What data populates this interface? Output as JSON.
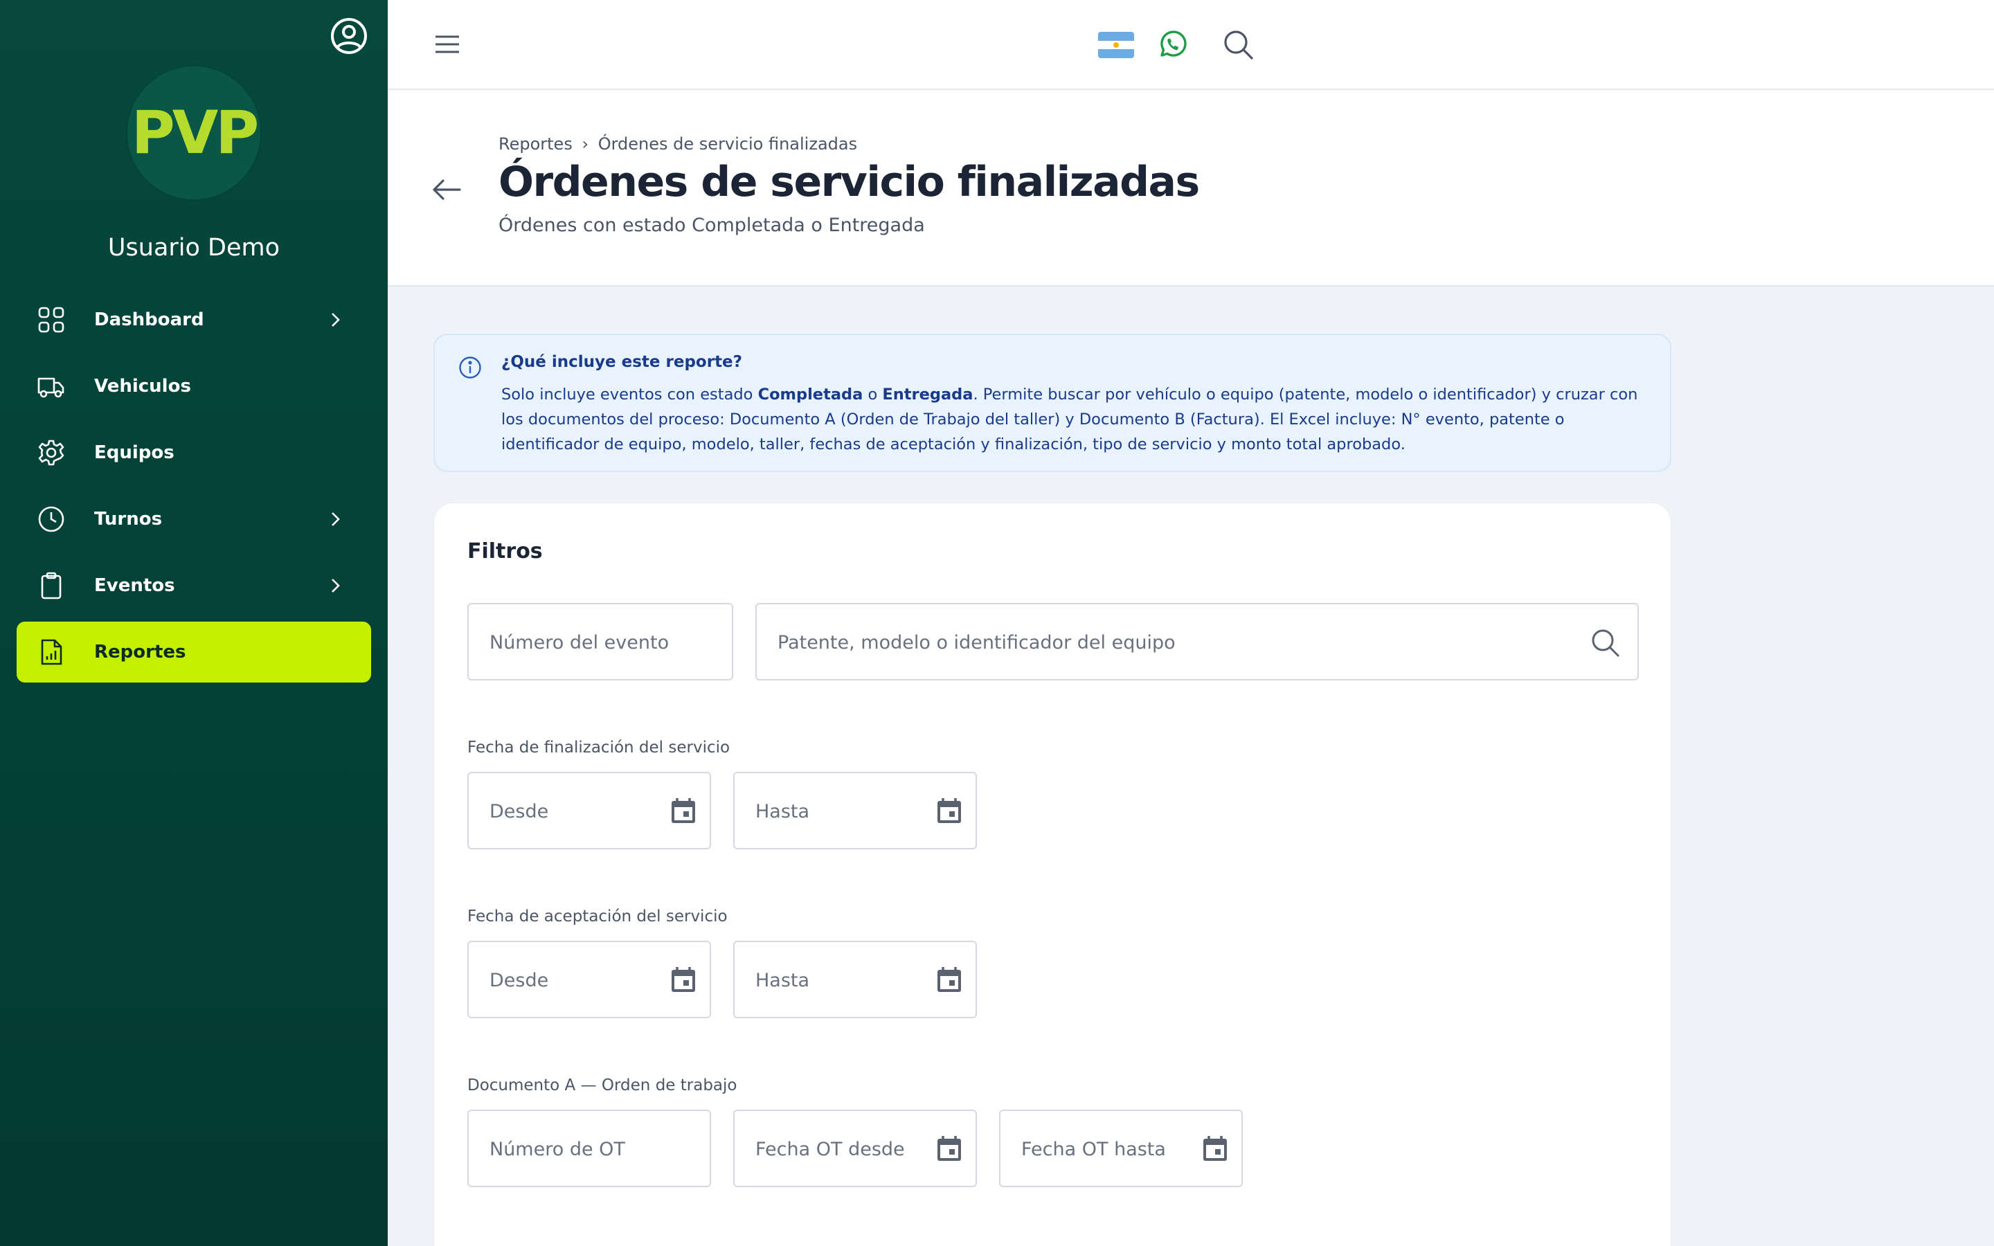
{
  "sidebar": {
    "user_name": "Usuario Demo",
    "logo_text": "PVP",
    "items": [
      {
        "label": "Dashboard",
        "icon": "grid-icon",
        "has_chevron": true,
        "active": false
      },
      {
        "label": "Vehiculos",
        "icon": "truck-icon",
        "has_chevron": false,
        "active": false
      },
      {
        "label": "Equipos",
        "icon": "gear-icon",
        "has_chevron": false,
        "active": false
      },
      {
        "label": "Turnos",
        "icon": "clock-icon",
        "has_chevron": true,
        "active": false
      },
      {
        "label": "Eventos",
        "icon": "clipboard-icon",
        "has_chevron": true,
        "active": false
      },
      {
        "label": "Reportes",
        "icon": "report-icon",
        "has_chevron": false,
        "active": true
      }
    ]
  },
  "topbar": {
    "icons": [
      "menu-icon",
      "argentina-flag-icon",
      "whatsapp-icon",
      "search-icon"
    ]
  },
  "header": {
    "breadcrumb": [
      "Reportes",
      "›",
      "Órdenes de servicio finalizadas"
    ],
    "title": "Órdenes de servicio finalizadas",
    "subtitle": "Órdenes con estado Completada o Entregada"
  },
  "info": {
    "title": "¿Qué incluye este reporte?",
    "body_pre": "Solo incluye eventos con estado ",
    "bold_1": "Completada",
    "body_mid": " o ",
    "bold_2": "Entregada",
    "body_post": ". Permite buscar por vehículo o equipo (patente, modelo o identificador) y cruzar con los documentos del proceso: Documento A (Orden de Trabajo del taller) y Documento B (Factura). El Excel incluye: N° evento, patente o identificador de equipo, modelo, taller, fechas de aceptación y finalización, tipo de servicio y monto total aprobado."
  },
  "filters": {
    "title": "Filtros",
    "event_number_placeholder": "Número del evento",
    "equipment_search_placeholder": "Patente, modelo o identificador del equipo",
    "completion_date": {
      "label": "Fecha de finalización del servicio",
      "from_placeholder": "Desde",
      "to_placeholder": "Hasta"
    },
    "acceptance_date": {
      "label": "Fecha de aceptación del servicio",
      "from_placeholder": "Desde",
      "to_placeholder": "Hasta"
    },
    "document_a": {
      "label": "Documento A — Orden de trabajo",
      "ot_number_placeholder": "Número de OT",
      "ot_from_placeholder": "Fecha OT desde",
      "ot_to_placeholder": "Fecha OT hasta"
    }
  },
  "colors": {
    "sidebar_bg": "#06483c",
    "accent": "#c4f000",
    "logo": "#b5dc2c",
    "info_text": "#1a3a8c",
    "info_bg": "#e9f3fd",
    "whatsapp": "#1f9d46"
  }
}
